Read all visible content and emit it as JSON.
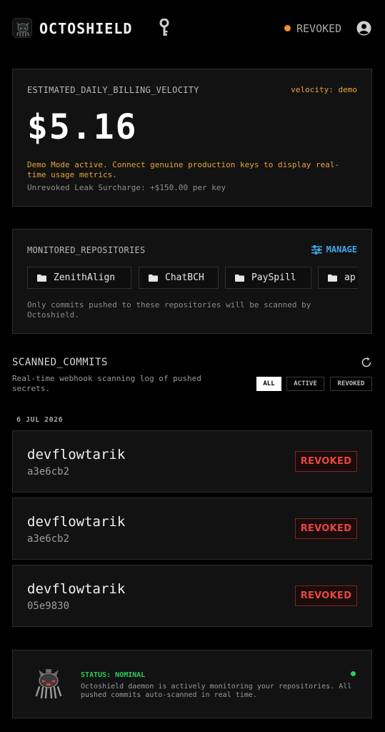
{
  "header": {
    "brand": "OCTOSHIELD",
    "status_label": "REVOKED",
    "status_color": "#f0902a",
    "icons": [
      "octoshield-logo-icon",
      "key-icon",
      "user-avatar-icon"
    ]
  },
  "billing": {
    "label": "ESTIMATED_DAILY_BILLING_VELOCITY",
    "velocity": "velocity: demo",
    "amount": "$5.16",
    "demo_note": "Demo Mode active. Connect genuine production keys to display real-time usage metrics.",
    "surcharge": "Unrevoked Leak Surcharge: +$150.00 per key"
  },
  "repos": {
    "label": "MONITORED_REPOSITORIES",
    "manage_label": "MANAGE",
    "items": [
      {
        "name": "ZenithAlign"
      },
      {
        "name": "ChatBCH"
      },
      {
        "name": "PaySpill"
      },
      {
        "name": "ap"
      }
    ],
    "note": "Only commits pushed to these repositories will be scanned by Octoshield."
  },
  "scanned": {
    "title": "SCANNED_COMMITS",
    "description": "Real-time webhook scanning log of pushed secrets.",
    "filters": [
      "ALL",
      "ACTIVE",
      "REVOKED"
    ],
    "selected_filter": "ALL",
    "date": "6 JUL 2026",
    "commits": [
      {
        "author": "devflowtarik",
        "hash": "a3e6cb2",
        "status": "REVOKED"
      },
      {
        "author": "devflowtarik",
        "hash": "a3e6cb2",
        "status": "REVOKED"
      },
      {
        "author": "devflowtarik",
        "hash": "05e9830",
        "status": "REVOKED"
      }
    ]
  },
  "status": {
    "title": "STATUS: NOMINAL",
    "description": "Octoshield daemon is actively monitoring your repositories. All pushed commits auto-scanned in real time.",
    "color": "#2ecc5a"
  }
}
